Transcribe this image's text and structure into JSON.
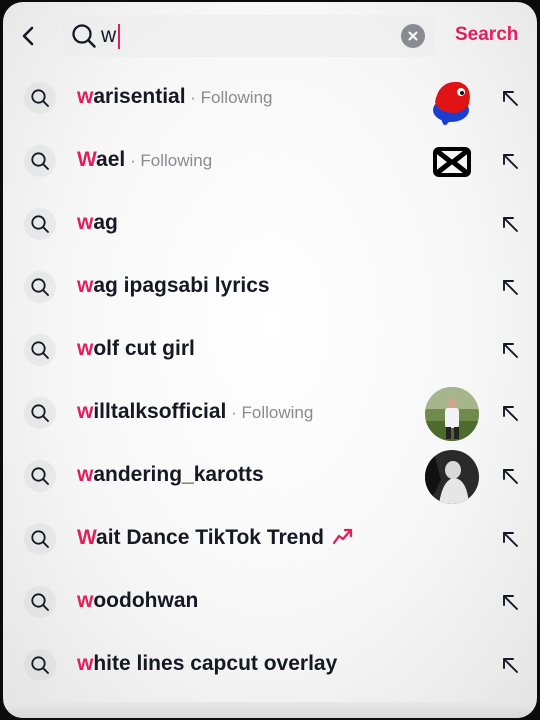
{
  "search": {
    "query": "w",
    "button_label": "Search"
  },
  "icons": {
    "back": "chevron-left-icon",
    "search": "search-icon",
    "clear": "clear-icon",
    "suggestion": "search-icon",
    "fill": "arrow-up-left-icon",
    "trending": "trending-up-icon"
  },
  "colors": {
    "accent": "#e31f5b",
    "text": "#161823",
    "secondary": "#8a8b91"
  },
  "suggestions": [
    {
      "match": "w",
      "rest": "arisential",
      "meta": " · Following",
      "thumb": "red-character-avatar"
    },
    {
      "match": "W",
      "rest": "ael",
      "meta": " · Following",
      "thumb": "capcut-logo-avatar"
    },
    {
      "match": "w",
      "rest": "ag",
      "meta": "",
      "thumb": ""
    },
    {
      "match": "w",
      "rest": "ag ipagsabi lyrics",
      "meta": "",
      "thumb": ""
    },
    {
      "match": "w",
      "rest": "olf cut girl",
      "meta": "",
      "thumb": ""
    },
    {
      "match": "w",
      "rest": "illtalksofficial",
      "meta": " · Following",
      "thumb": "person-photo-avatar"
    },
    {
      "match": "w",
      "rest": "andering_karotts",
      "meta": "",
      "thumb": "dark-photo-avatar"
    },
    {
      "match": "W",
      "rest": "ait Dance TikTok Trend",
      "meta": "",
      "thumb": "",
      "trending": true
    },
    {
      "match": "w",
      "rest": "oodohwan",
      "meta": "",
      "thumb": ""
    },
    {
      "match": "w",
      "rest": "hite lines capcut overlay",
      "meta": "",
      "thumb": ""
    }
  ]
}
